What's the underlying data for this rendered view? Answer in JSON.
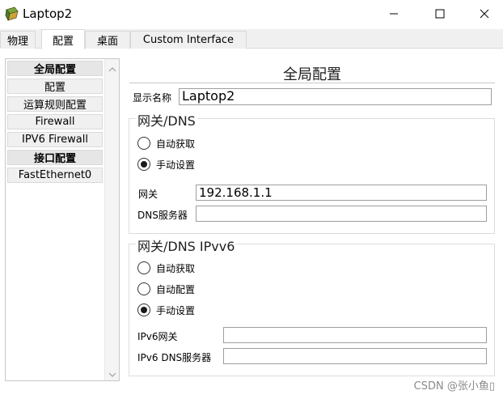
{
  "window": {
    "title": "Laptop2",
    "icon": "laptop-app-icon",
    "controls": [
      "minimize-icon",
      "maximize-icon",
      "close-icon"
    ]
  },
  "tabs": [
    {
      "label": "物理",
      "active": false
    },
    {
      "label": "配置",
      "active": true
    },
    {
      "label": "桌面",
      "active": false
    },
    {
      "label": "Custom Interface",
      "active": false
    }
  ],
  "sidebar": {
    "items": [
      {
        "label": "全局配置",
        "header": true
      },
      {
        "label": "配置",
        "header": false
      },
      {
        "label": "运算规则配置",
        "header": false
      },
      {
        "label": "Firewall",
        "header": false
      },
      {
        "label": "IPV6 Firewall",
        "header": false
      },
      {
        "label": "接口配置",
        "header": true
      },
      {
        "label": "FastEthernet0",
        "header": false
      }
    ]
  },
  "panel": {
    "title": "全局配置",
    "display_name_label": "显示名称",
    "display_name_value": "Laptop2"
  },
  "gateway_dns": {
    "legend": "网关/DNS",
    "radio_auto": "自动获取",
    "radio_manual": "手动设置",
    "selected": "manual",
    "gateway_label": "网关",
    "gateway_value": "192.168.1.1",
    "dns_label": "DNS服务器",
    "dns_value": ""
  },
  "gateway_dns_ipv6": {
    "legend": "网关/DNS IPvv6",
    "radio_auto": "自动获取",
    "radio_autoconfig": "自动配置",
    "radio_manual": "手动设置",
    "selected": "manual",
    "gateway_label": "IPv6网关",
    "gateway_value": "",
    "dns_label": "IPv6 DNS服务器",
    "dns_value": ""
  },
  "watermark": "CSDN @张小鱼▯"
}
